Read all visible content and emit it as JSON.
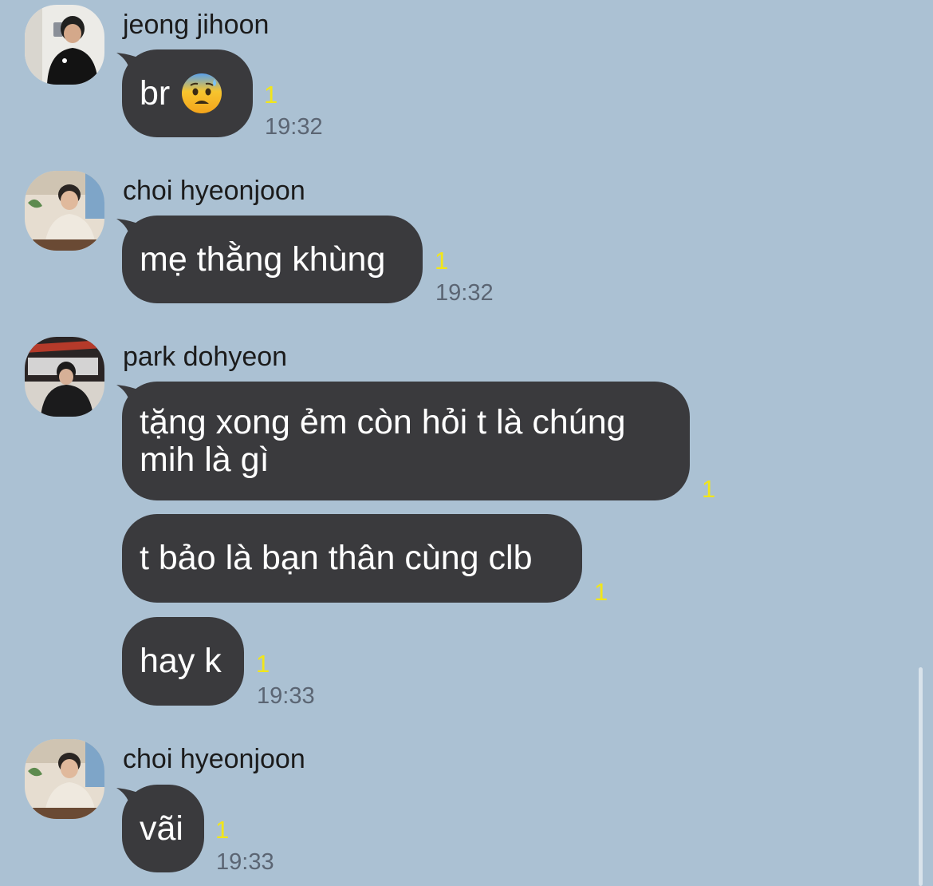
{
  "messages": [
    {
      "sender": "jeong jihoon",
      "avatar_icon": "avatar-jeong-jihoon",
      "bubbles": [
        {
          "text": "br",
          "emoji": "anxious-face-with-sweat",
          "unread": "1",
          "time": "19:32"
        }
      ]
    },
    {
      "sender": "choi hyeonjoon",
      "avatar_icon": "avatar-choi-hyeonjoon",
      "bubbles": [
        {
          "text": "mẹ thằng khùng",
          "unread": "1",
          "time": "19:32"
        }
      ]
    },
    {
      "sender": "park dohyeon",
      "avatar_icon": "avatar-park-dohyeon",
      "bubbles": [
        {
          "text": "tặng xong ẻm còn hỏi t là chúng mih là gì",
          "unread": "1",
          "time": ""
        },
        {
          "text": "t bảo là bạn thân cùng clb",
          "unread": "1",
          "time": ""
        },
        {
          "text": "hay k",
          "unread": "1",
          "time": "19:33"
        }
      ]
    },
    {
      "sender": "choi hyeonjoon",
      "avatar_icon": "avatar-choi-hyeonjoon",
      "bubbles": [
        {
          "text": "vãi",
          "unread": "1",
          "time": "19:33"
        }
      ]
    }
  ],
  "colors": {
    "background": "#abc1d3",
    "bubble": "#3a3a3d",
    "bubble_text": "#ffffff",
    "unread": "#f2e619",
    "time": "#5b6573"
  }
}
